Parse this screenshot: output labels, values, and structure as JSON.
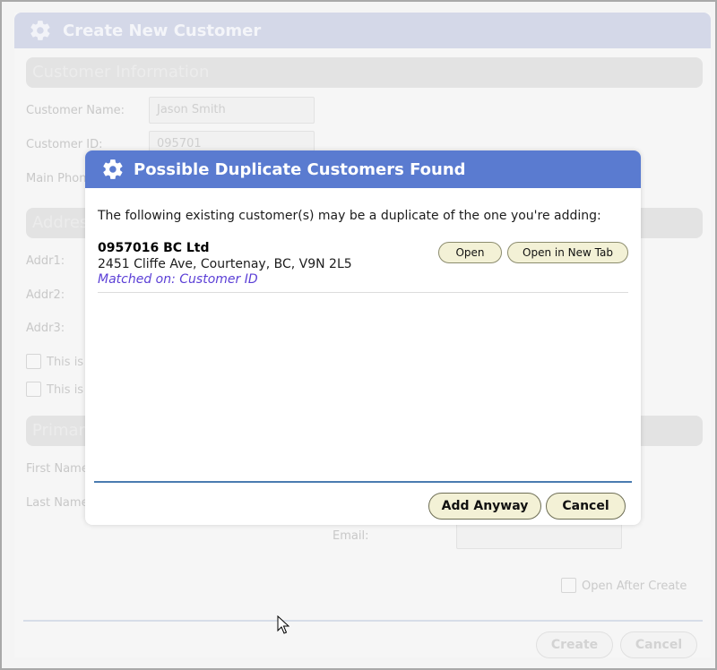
{
  "background_window": {
    "title": "Create New Customer",
    "sections": {
      "customer_info": "Customer Information",
      "address": "Addres",
      "primary": "Primar"
    },
    "fields": {
      "customer_name_label": "Customer Name:",
      "customer_name_value": "Jason Smith",
      "customer_id_label": "Customer ID:",
      "customer_id_value": "095701",
      "main_phone_label": "Main Phon",
      "addr1_label": "Addr1:",
      "addr2_label": "Addr2:",
      "addr3_label": "Addr3:",
      "check1_label": "This is",
      "check2_label": "This is",
      "first_name_label": "First Name",
      "last_name_label": "Last Name",
      "email_label": "Email:"
    },
    "open_after_create_label": "Open After Create",
    "create_label": "Create",
    "cancel_label": "Cancel"
  },
  "dialog": {
    "title": "Possible Duplicate Customers Found",
    "intro": "The following existing customer(s) may be a duplicate of the one you're adding:",
    "matches": [
      {
        "name": "0957016 BC Ltd",
        "address": "2451 Cliffe Ave, Courtenay, BC, V9N 2L5",
        "matched_on": "Matched on: Customer ID",
        "open_label": "Open",
        "open_new_tab_label": "Open in New Tab"
      }
    ],
    "add_anyway_label": "Add Anyway",
    "cancel_label": "Cancel"
  },
  "colors": {
    "dialog_header": "#5a7bd0",
    "button_fill": "#f3f1d6",
    "matched_on_text": "#5b3fd6",
    "accent_rule": "#4a7bb0"
  },
  "icons": {
    "dialog": "gear-icon",
    "background_window": "gear-icon"
  }
}
